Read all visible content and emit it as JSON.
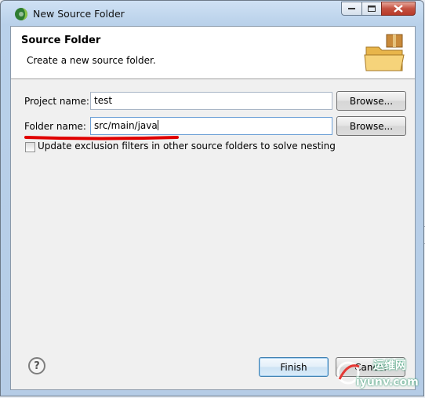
{
  "window": {
    "title": "New Source Folder"
  },
  "banner": {
    "title": "Source Folder",
    "description": "Create a new source folder.",
    "icon": "folder-with-package-icon"
  },
  "form": {
    "project_label": "Project name:",
    "project_value": "test",
    "folder_label": "Folder name:",
    "folder_value": "src/main/java",
    "browse_label": "Browse...",
    "checkbox_label": "Update exclusion filters in other source folders to solve nesting",
    "checkbox_checked": false
  },
  "footer": {
    "finish_label": "Finish",
    "cancel_label": "Cancel",
    "help_icon": "help-question-icon"
  },
  "watermark": {
    "text_top": "运维网",
    "text_bottom": "iyunv.com"
  },
  "colors": {
    "annotation_underline": "#e00000",
    "titlebar": "#b9d1ea",
    "dialog_bg": "#f0f0f0"
  }
}
